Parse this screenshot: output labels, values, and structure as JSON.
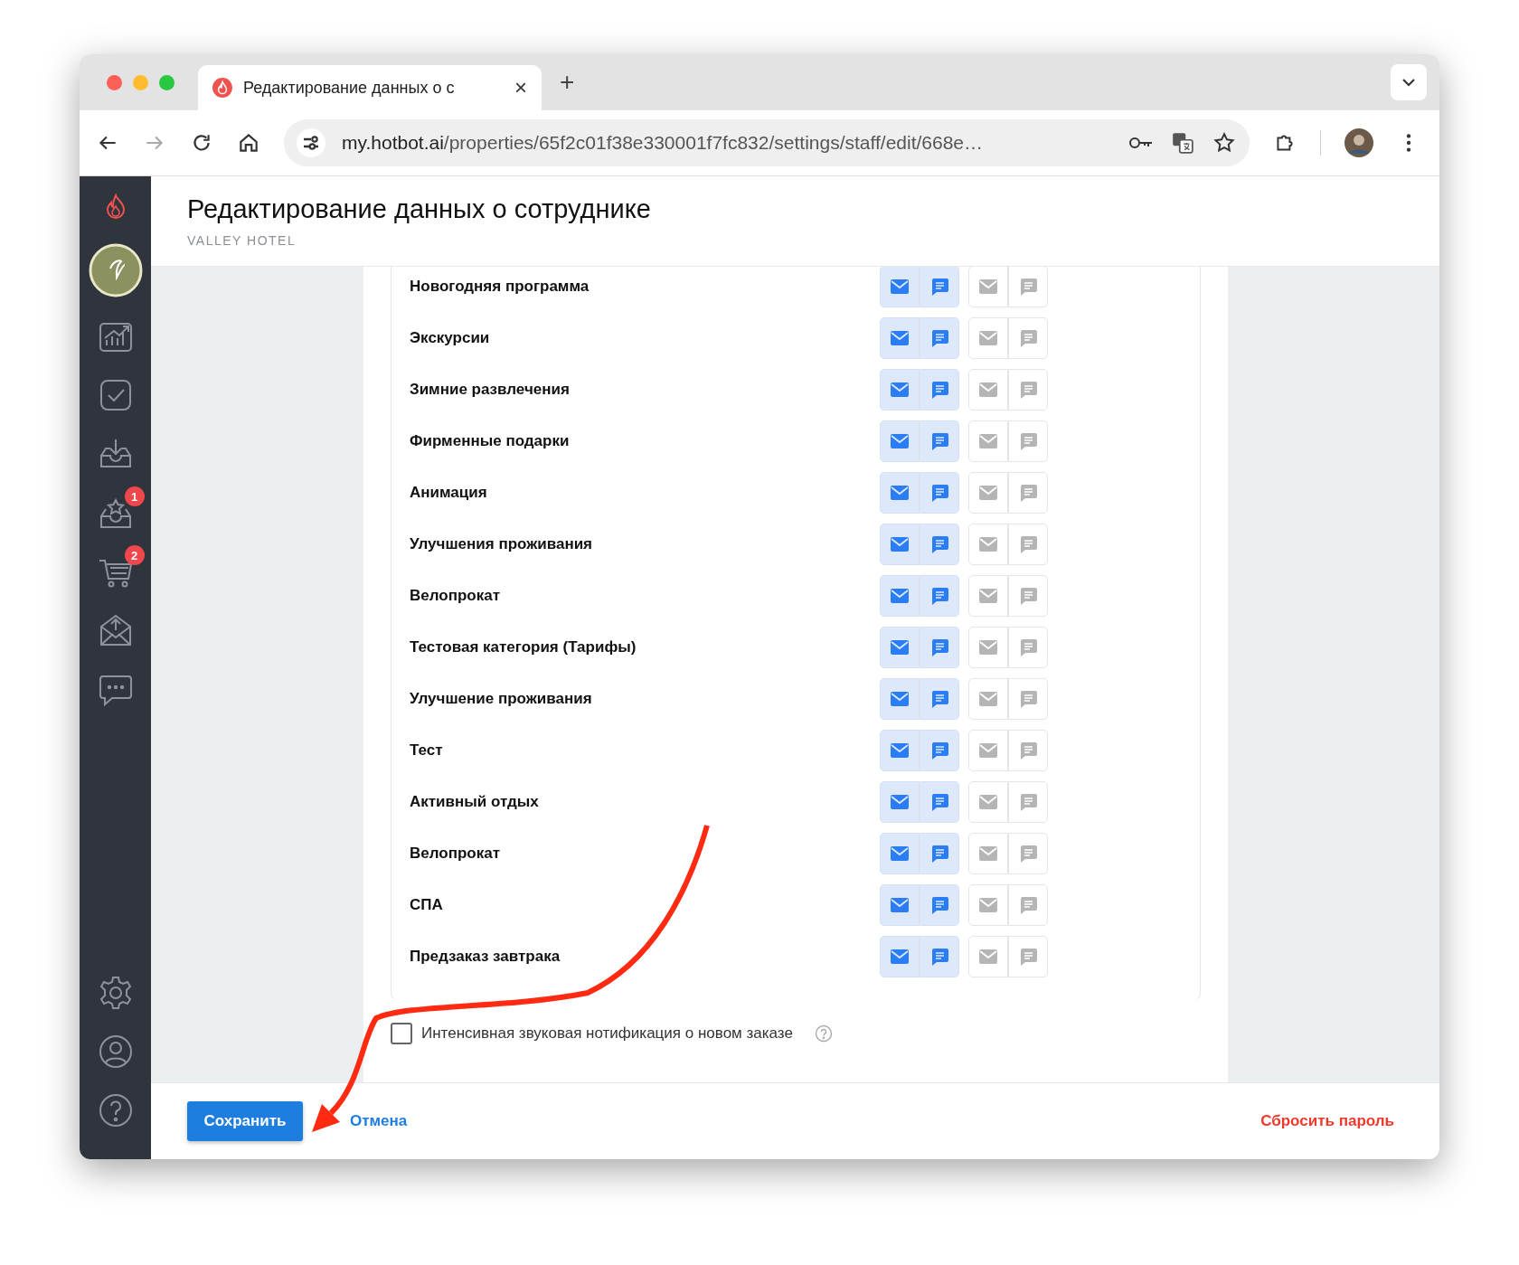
{
  "browser": {
    "tab": {
      "title": "Редактирование данных о с",
      "close": "×"
    },
    "new_tab": "+",
    "address": {
      "host": "my.hotbot.ai",
      "path": "/properties/65f2c01f38e330001f7fc832/settings/staff/edit/668e…"
    }
  },
  "sidebar": {
    "items": [
      {
        "kind": "chart"
      },
      {
        "kind": "check"
      },
      {
        "kind": "download"
      },
      {
        "kind": "star",
        "badge": "1"
      },
      {
        "kind": "cart",
        "badge": "2"
      },
      {
        "kind": "upload"
      },
      {
        "kind": "chat"
      }
    ],
    "bottom_items": [
      {
        "kind": "settings"
      },
      {
        "kind": "user"
      },
      {
        "kind": "help"
      }
    ]
  },
  "header": {
    "title": "Редактирование данных о сотруднике",
    "subtitle": "VALLEY HOTEL"
  },
  "rows": [
    {
      "label": "Новогодняя программа",
      "toggles": [
        {
          "kind": "mail",
          "on": true
        },
        {
          "kind": "chat",
          "on": true
        },
        {
          "kind": "mail",
          "on": false
        },
        {
          "kind": "chat",
          "on": false
        }
      ]
    },
    {
      "label": "Экскурсии",
      "toggles": [
        {
          "kind": "mail",
          "on": true
        },
        {
          "kind": "chat",
          "on": true
        },
        {
          "kind": "mail",
          "on": false
        },
        {
          "kind": "chat",
          "on": false
        }
      ]
    },
    {
      "label": "Зимние развлечения",
      "toggles": [
        {
          "kind": "mail",
          "on": true
        },
        {
          "kind": "chat",
          "on": true
        },
        {
          "kind": "mail",
          "on": false
        },
        {
          "kind": "chat",
          "on": false
        }
      ]
    },
    {
      "label": "Фирменные подарки",
      "toggles": [
        {
          "kind": "mail",
          "on": true
        },
        {
          "kind": "chat",
          "on": true
        },
        {
          "kind": "mail",
          "on": false
        },
        {
          "kind": "chat",
          "on": false
        }
      ]
    },
    {
      "label": "Анимация",
      "toggles": [
        {
          "kind": "mail",
          "on": true
        },
        {
          "kind": "chat",
          "on": true
        },
        {
          "kind": "mail",
          "on": false
        },
        {
          "kind": "chat",
          "on": false
        }
      ]
    },
    {
      "label": "Улучшения проживания",
      "toggles": [
        {
          "kind": "mail",
          "on": true
        },
        {
          "kind": "chat",
          "on": true
        },
        {
          "kind": "mail",
          "on": false
        },
        {
          "kind": "chat",
          "on": false
        }
      ]
    },
    {
      "label": "Велопрокат",
      "toggles": [
        {
          "kind": "mail",
          "on": true
        },
        {
          "kind": "chat",
          "on": true
        },
        {
          "kind": "mail",
          "on": false
        },
        {
          "kind": "chat",
          "on": false
        }
      ]
    },
    {
      "label": "Тестовая категория (Тарифы)",
      "toggles": [
        {
          "kind": "mail",
          "on": true
        },
        {
          "kind": "chat",
          "on": true
        },
        {
          "kind": "mail",
          "on": false
        },
        {
          "kind": "chat",
          "on": false
        }
      ]
    },
    {
      "label": "Улучшение проживания",
      "toggles": [
        {
          "kind": "mail",
          "on": true
        },
        {
          "kind": "chat",
          "on": true
        },
        {
          "kind": "mail",
          "on": false
        },
        {
          "kind": "chat",
          "on": false
        }
      ]
    },
    {
      "label": "Тест",
      "toggles": [
        {
          "kind": "mail",
          "on": true
        },
        {
          "kind": "chat",
          "on": true
        },
        {
          "kind": "mail",
          "on": false
        },
        {
          "kind": "chat",
          "on": false
        }
      ]
    },
    {
      "label": "Активный отдых",
      "toggles": [
        {
          "kind": "mail",
          "on": true
        },
        {
          "kind": "chat",
          "on": true
        },
        {
          "kind": "mail",
          "on": false
        },
        {
          "kind": "chat",
          "on": false
        }
      ]
    },
    {
      "label": "Велопрокат",
      "toggles": [
        {
          "kind": "mail",
          "on": true
        },
        {
          "kind": "chat",
          "on": true
        },
        {
          "kind": "mail",
          "on": false
        },
        {
          "kind": "chat",
          "on": false
        }
      ]
    },
    {
      "label": "СПА",
      "toggles": [
        {
          "kind": "mail",
          "on": true
        },
        {
          "kind": "chat",
          "on": true
        },
        {
          "kind": "mail",
          "on": false
        },
        {
          "kind": "chat",
          "on": false
        }
      ]
    },
    {
      "label": "Предзаказ завтрака",
      "toggles": [
        {
          "kind": "mail",
          "on": true
        },
        {
          "kind": "chat",
          "on": true
        },
        {
          "kind": "mail",
          "on": false
        },
        {
          "kind": "chat",
          "on": false
        }
      ]
    }
  ],
  "sound_option": {
    "label": "Интенсивная звуковая нотификация о новом заказе",
    "checked": false
  },
  "footer": {
    "save": "Сохранить",
    "cancel": "Отмена",
    "reset": "Сбросить пароль"
  }
}
